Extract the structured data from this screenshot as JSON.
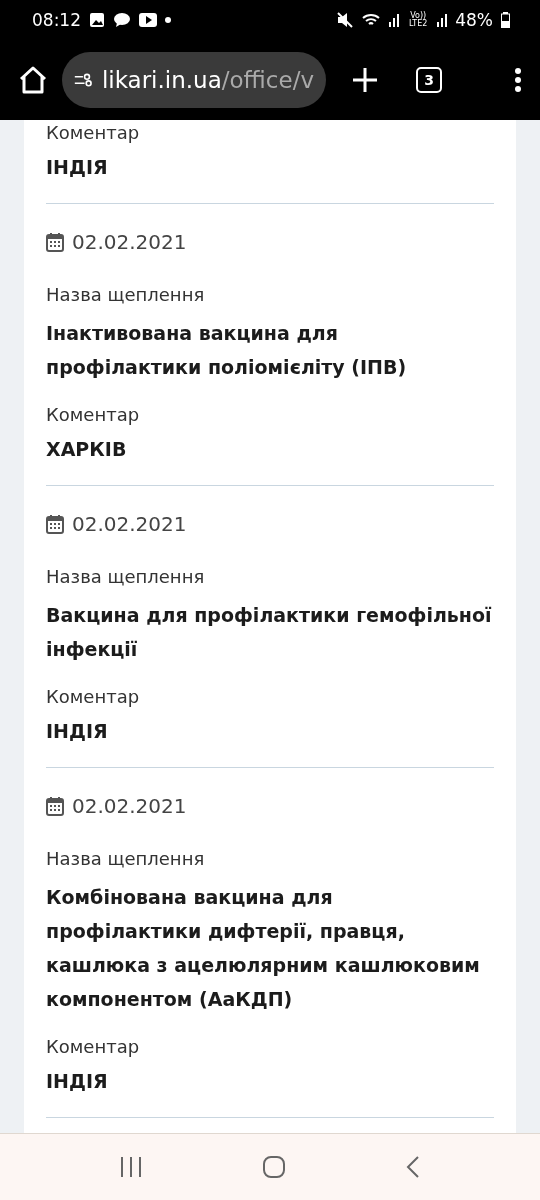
{
  "status_bar": {
    "time": "08:12",
    "battery": "48%",
    "network": "Vo)) LTE2"
  },
  "browser": {
    "url_host": "likari.in.ua",
    "url_path": "/office/v",
    "tab_count": "3"
  },
  "top_fragment": {
    "comment_label": "Коментар",
    "comment": "ІНДІЯ"
  },
  "records": [
    {
      "date": "02.02.2021",
      "name_label": "Назва щеплення",
      "name": "Інактивована вакцина для профілактики поліомієліту (ІПВ)",
      "comment_label": "Коментар",
      "comment": "ХАРКІВ"
    },
    {
      "date": "02.02.2021",
      "name_label": "Назва щеплення",
      "name": "Вакцина для профілактики гемофільної інфекції",
      "comment_label": "Коментар",
      "comment": "ІНДІЯ"
    },
    {
      "date": "02.02.2021",
      "name_label": "Назва щеплення",
      "name": "Комбінована вакцина для профілактики дифтерії, правця, кашлюка з ацелюлярним кашлюковим компонентом (АаКДП)",
      "comment_label": "Коментар",
      "comment": "ІНДІЯ"
    }
  ]
}
